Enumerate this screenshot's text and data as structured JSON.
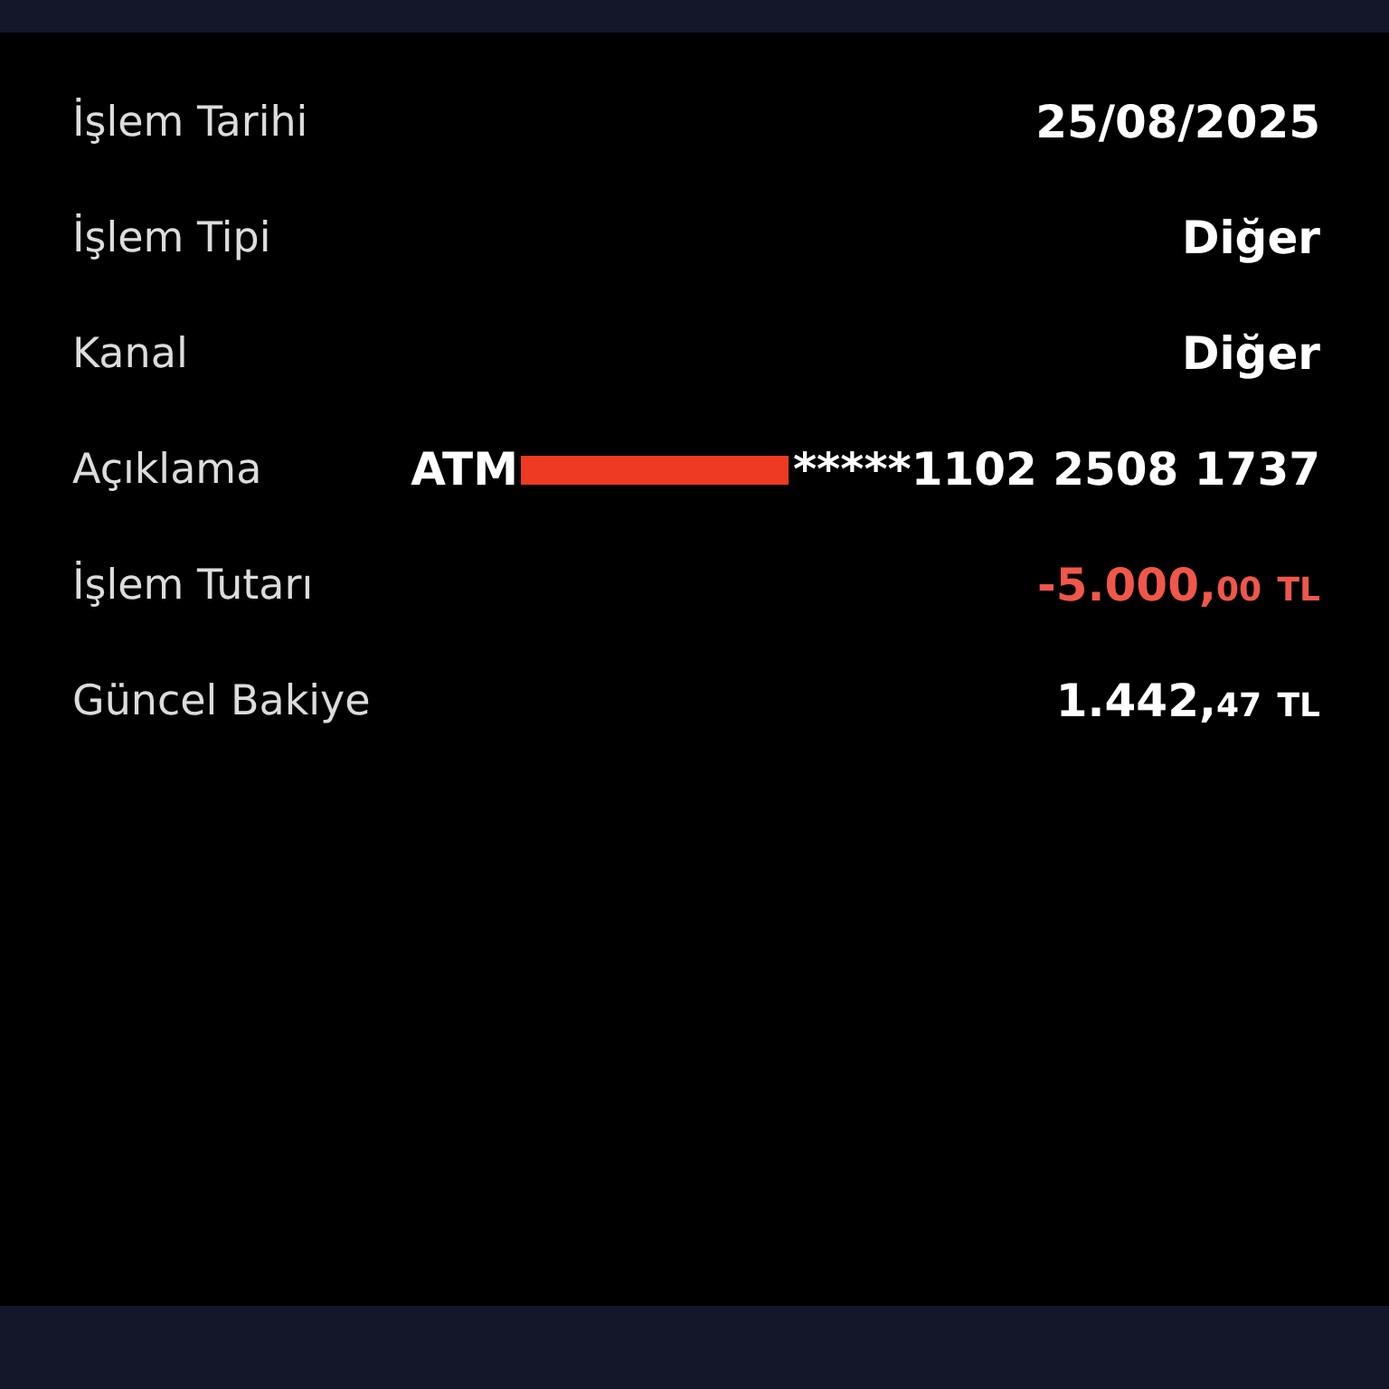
{
  "rows": [
    {
      "label": "İşlem Tarihi",
      "value": {
        "kind": "text",
        "text": "25/08/2025"
      }
    },
    {
      "label": "İşlem Tipi",
      "value": {
        "kind": "text",
        "text": "Diğer"
      }
    },
    {
      "label": "Kanal",
      "value": {
        "kind": "text",
        "text": "Diğer"
      }
    },
    {
      "label": "Açıklama",
      "value": {
        "kind": "redacted",
        "before": "ATM",
        "after": "*****1102 2508 1737"
      }
    },
    {
      "label": "İşlem Tutarı",
      "value": {
        "kind": "amount",
        "negative": true,
        "main": "-5.000,",
        "decimals": "00",
        "currency": "TL"
      }
    },
    {
      "label": "Güncel Bakiye",
      "value": {
        "kind": "amount",
        "negative": false,
        "main": "1.442,",
        "decimals": "47",
        "currency": "TL"
      }
    }
  ]
}
